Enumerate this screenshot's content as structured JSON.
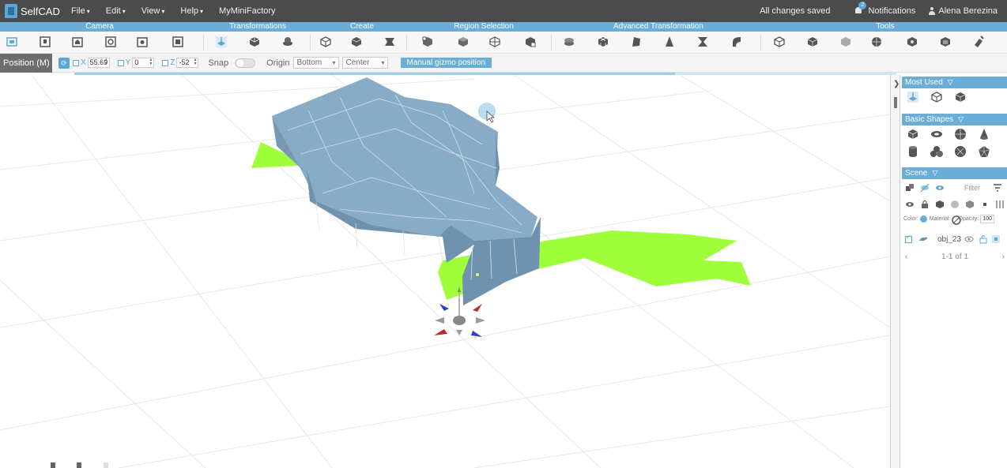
{
  "app": {
    "name": "SelfCAD"
  },
  "menu": [
    {
      "label": "File",
      "caret": true
    },
    {
      "label": "Edit",
      "caret": true
    },
    {
      "label": "View",
      "caret": true
    },
    {
      "label": "Help",
      "caret": true
    },
    {
      "label": "MyMiniFactory",
      "caret": false
    }
  ],
  "status": {
    "saved": "All changes saved",
    "notifications_label": "Notifications",
    "notifications_count": "2",
    "user_name": "Alena Berezina"
  },
  "categories": [
    "Camera",
    "Transformations",
    "Create",
    "Region Selection",
    "Advanced Transformation",
    "Tools"
  ],
  "options": {
    "mode_label": "Position (M)",
    "x_label": "X",
    "x_value": "55.69",
    "y_label": "Y",
    "y_value": "0",
    "z_label": "Z",
    "z_value": "-52",
    "snap_label": "Snap",
    "origin_label": "Origin",
    "origin_vertical": "Bottom",
    "origin_horizontal": "Center",
    "manual_gizmo_label": "Manual gizmo position"
  },
  "sidebar": {
    "most_used_title": "Most Used",
    "basic_shapes_title": "Basic Shapes",
    "scene_title": "Scene",
    "filter_placeholder": "Filter",
    "color_label": "Color:",
    "material_label": "Material:",
    "opacity_label": "Opacity:",
    "opacity_value": "100",
    "object_name": "obj_23",
    "pager_text": "1-1 of 1"
  },
  "colors": {
    "accent": "#6aaed8",
    "menubar": "#4b4b4b",
    "shadow": "#9eff3a",
    "model_top": "#88abc6",
    "model_side": "#6f92ae"
  }
}
